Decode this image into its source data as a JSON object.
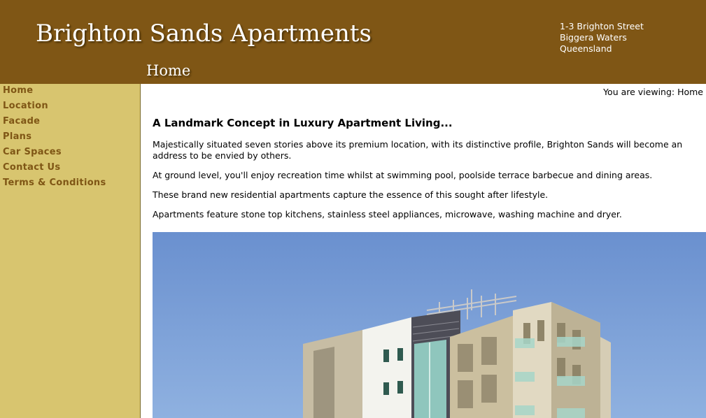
{
  "header": {
    "site_title": "Brighton Sands Apartments",
    "address": [
      "1-3 Brighton Street",
      "Biggera Waters",
      "Queensland"
    ],
    "section_title": "Home"
  },
  "sidebar": {
    "items": [
      {
        "label": "Home"
      },
      {
        "label": "Location"
      },
      {
        "label": "Facade"
      },
      {
        "label": "Plans"
      },
      {
        "label": "Car Spaces"
      },
      {
        "label": "Contact Us"
      },
      {
        "label": "Terms & Conditions"
      }
    ]
  },
  "breadcrumb": "You are viewing: Home",
  "main": {
    "heading": "A Landmark Concept in Luxury Apartment Living...",
    "paragraphs": [
      "Majestically situated seven stories above its premium location, with its distinctive profile, Brighton Sands will become an address to be envied by others.",
      "At ground level, you'll enjoy recreation time whilst at swimming pool, poolside terrace barbecue and dining areas.",
      "These brand new residential apartments capture the essence of this sought after lifestyle.",
      "Apartments feature stone top kitchens, stainless steel appliances, microwave, washing machine and dryer."
    ]
  },
  "colors": {
    "header_bg": "#7f5615",
    "sidebar_bg": "#d8c56f",
    "nav_link": "#7f5615",
    "sky": "#6a93d0"
  }
}
